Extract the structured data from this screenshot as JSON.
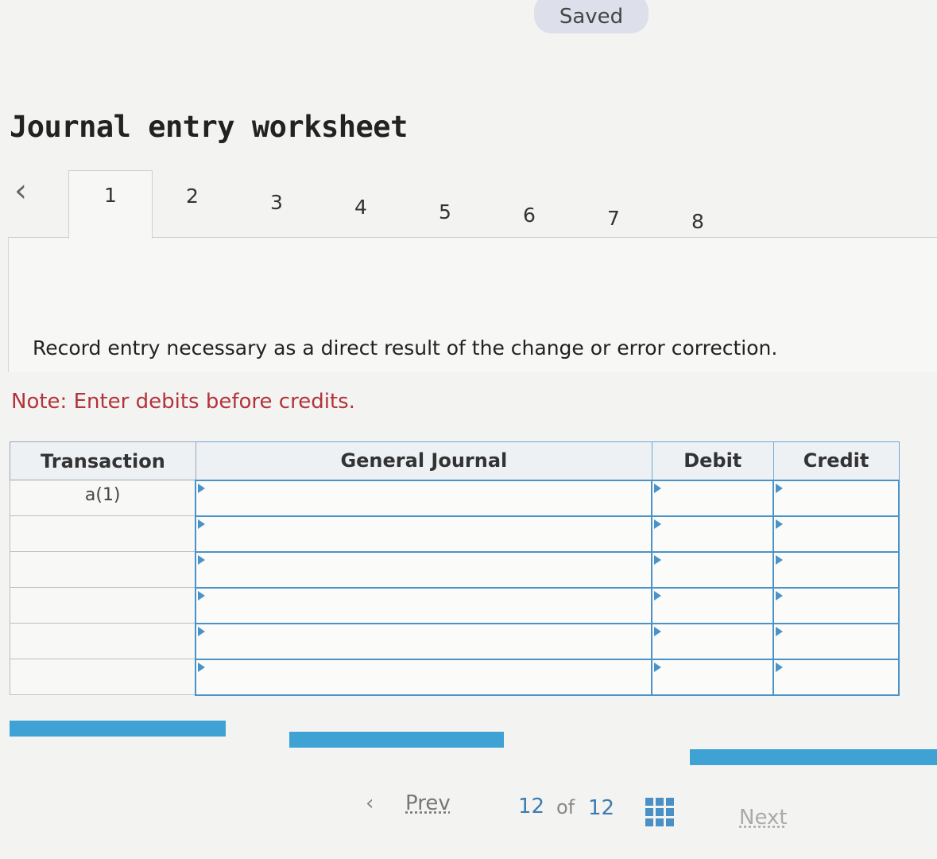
{
  "status": {
    "saved_label": "Saved"
  },
  "title": "Journal entry worksheet",
  "tabs": {
    "prev_icon": "chevron-left-icon",
    "items": [
      "1",
      "2",
      "3",
      "4",
      "5",
      "6",
      "7",
      "8"
    ],
    "active_index": 0
  },
  "instruction": "Record entry necessary as a direct result of the change or error correction.",
  "note": "Note: Enter debits before credits.",
  "journal_table": {
    "headers": {
      "transaction": "Transaction",
      "general_journal": "General Journal",
      "debit": "Debit",
      "credit": "Credit"
    },
    "rows": [
      {
        "transaction": "a(1)",
        "general_journal": "",
        "debit": "",
        "credit": ""
      },
      {
        "transaction": "",
        "general_journal": "",
        "debit": "",
        "credit": ""
      },
      {
        "transaction": "",
        "general_journal": "",
        "debit": "",
        "credit": ""
      },
      {
        "transaction": "",
        "general_journal": "",
        "debit": "",
        "credit": ""
      },
      {
        "transaction": "",
        "general_journal": "",
        "debit": "",
        "credit": ""
      },
      {
        "transaction": "",
        "general_journal": "",
        "debit": "",
        "credit": ""
      }
    ]
  },
  "pager": {
    "prev_label": "Prev",
    "current_page": "12",
    "of_label": "of",
    "total_pages": "12",
    "next_label": "Next"
  },
  "colors": {
    "accent": "#3fa2d4",
    "note": "#b3333a",
    "input_border": "#4a93c9"
  }
}
